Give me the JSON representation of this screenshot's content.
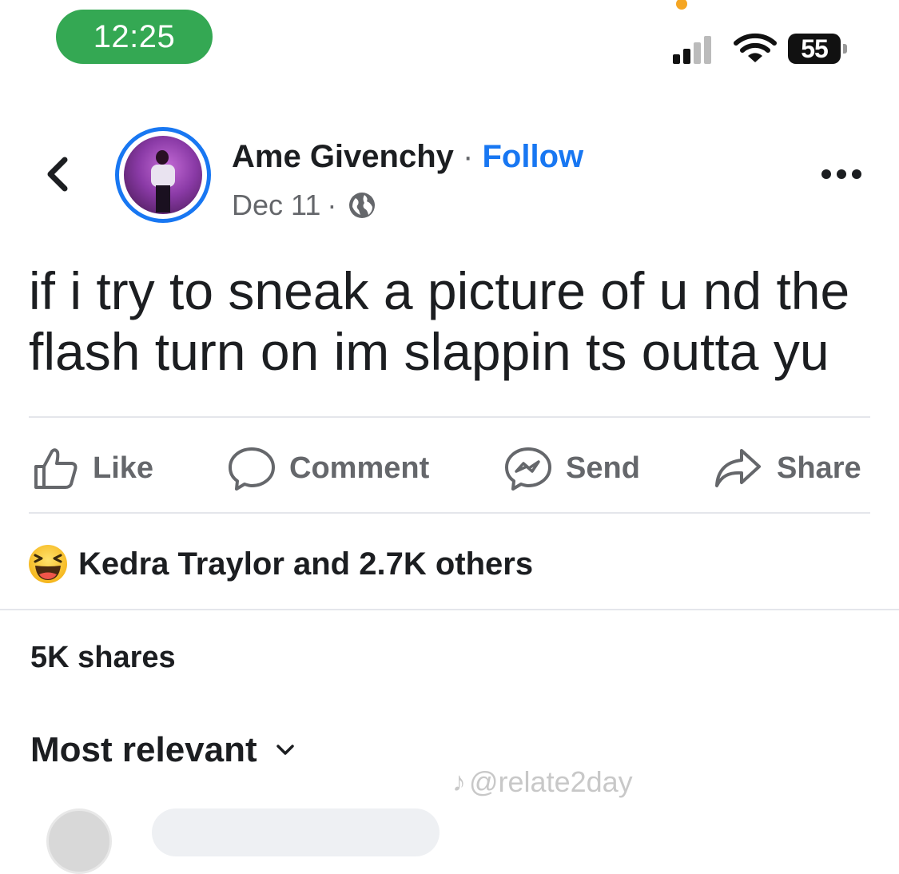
{
  "status_bar": {
    "time": "12:25",
    "battery": "55",
    "icons": [
      "signal-icon",
      "wifi-icon",
      "battery-icon"
    ],
    "time_pill_color": "#34a853"
  },
  "header": {
    "back_icon": "chevron-left-icon",
    "author_name": "Ame Givenchy",
    "separator": "·",
    "follow_label": "Follow",
    "date": "Dec 11",
    "date_separator": "·",
    "privacy_icon": "globe-icon",
    "more_icon": "more-horizontal-icon"
  },
  "post": {
    "text_line1": "if i try to sneak a picture of u nd the",
    "text_line2": "flash turn on im slappin ts outta yu"
  },
  "actions": [
    {
      "label": "Like",
      "icon": "thumbs-up-icon"
    },
    {
      "label": "Comment",
      "icon": "comment-icon"
    },
    {
      "label": "Send",
      "icon": "messenger-icon"
    },
    {
      "label": "Share",
      "icon": "share-arrow-icon"
    }
  ],
  "reactions": {
    "icon": "haha-reaction-icon",
    "text": "Kedra Traylor and 2.7K others"
  },
  "shares": "5K shares",
  "comments_sort": {
    "label": "Most relevant",
    "icon": "chevron-down-icon"
  },
  "watermark": {
    "text": "@relate2day",
    "icon": "tiktok-icon"
  },
  "colors": {
    "accent": "#1877f2",
    "text": "#1c1e21",
    "secondary": "#65676b"
  }
}
